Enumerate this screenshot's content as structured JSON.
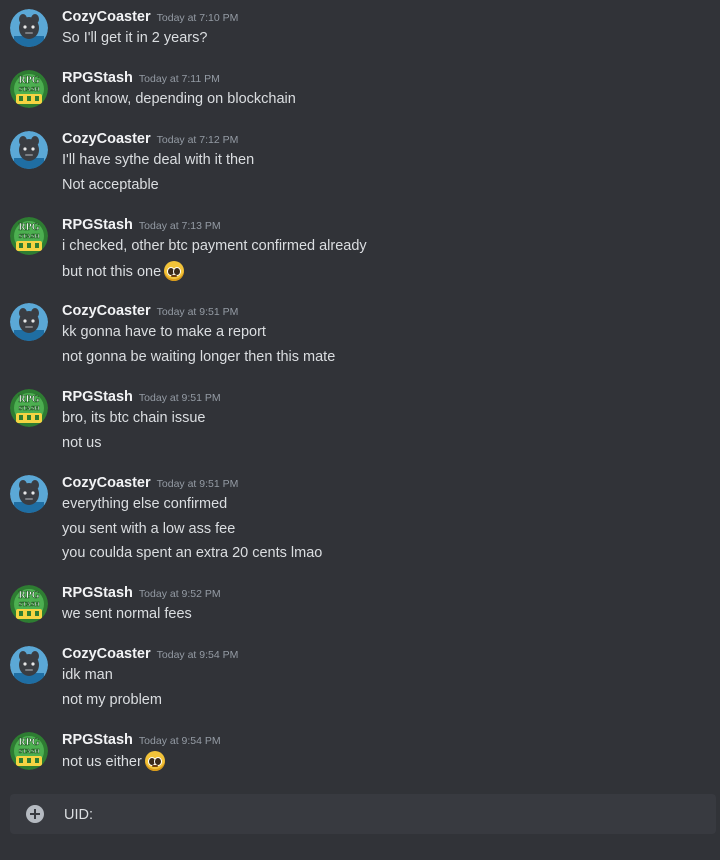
{
  "messages": [
    {
      "author": "CozyCoaster",
      "avatar": "cozy",
      "time": "Today at 7:10 PM",
      "lines": [
        {
          "text": "So I'll get it in 2 years?"
        }
      ]
    },
    {
      "author": "RPGStash",
      "avatar": "rpg",
      "time": "Today at 7:11 PM",
      "lines": [
        {
          "text": "dont know, depending on blockchain"
        }
      ]
    },
    {
      "author": "CozyCoaster",
      "avatar": "cozy",
      "time": "Today at 7:12 PM",
      "lines": [
        {
          "text": "I'll have sythe deal with it then"
        },
        {
          "text": "Not acceptable"
        }
      ]
    },
    {
      "author": "RPGStash",
      "avatar": "rpg",
      "time": "Today at 7:13 PM",
      "lines": [
        {
          "text": "i checked, other btc payment confirmed already"
        },
        {
          "text": "but not this one",
          "emoji": "pleading-face"
        }
      ]
    },
    {
      "author": "CozyCoaster",
      "avatar": "cozy",
      "time": "Today at 9:51 PM",
      "lines": [
        {
          "text": "kk gonna have to make a report"
        },
        {
          "text": "not gonna be waiting longer then this mate"
        }
      ]
    },
    {
      "author": "RPGStash",
      "avatar": "rpg",
      "time": "Today at 9:51 PM",
      "lines": [
        {
          "text": "bro, its btc chain issue"
        },
        {
          "text": "not us"
        }
      ]
    },
    {
      "author": "CozyCoaster",
      "avatar": "cozy",
      "time": "Today at 9:51 PM",
      "lines": [
        {
          "text": "everything else confirmed"
        },
        {
          "text": "you sent with a low ass fee"
        },
        {
          "text": "you coulda spent an extra 20 cents lmao"
        }
      ]
    },
    {
      "author": "RPGStash",
      "avatar": "rpg",
      "time": "Today at 9:52 PM",
      "lines": [
        {
          "text": "we sent normal fees"
        }
      ]
    },
    {
      "author": "CozyCoaster",
      "avatar": "cozy",
      "time": "Today at 9:54 PM",
      "lines": [
        {
          "text": "idk man"
        },
        {
          "text": "not my problem"
        }
      ]
    },
    {
      "author": "RPGStash",
      "avatar": "rpg",
      "time": "Today at 9:54 PM",
      "lines": [
        {
          "text": "not us either",
          "emoji": "pleading-face"
        }
      ]
    }
  ],
  "avatars": {
    "cozy": {
      "icon": "cozy-avatar-icon",
      "bg": "#5ba8d6",
      "fg": "#2f3136"
    },
    "rpg": {
      "icon": "rpg-stash-logo-icon",
      "text_top": "RPG",
      "text_mid": "STASH",
      "bg": "#2e7d32",
      "fg": "#f5d442"
    }
  },
  "composer": {
    "placeholder": "UID:",
    "add_icon": "plus-circle-icon"
  },
  "colors": {
    "background": "#313338",
    "composer": "#383a40",
    "username": "#f2f3f5",
    "timestamp": "#949ba4",
    "text": "#dbdee1"
  }
}
